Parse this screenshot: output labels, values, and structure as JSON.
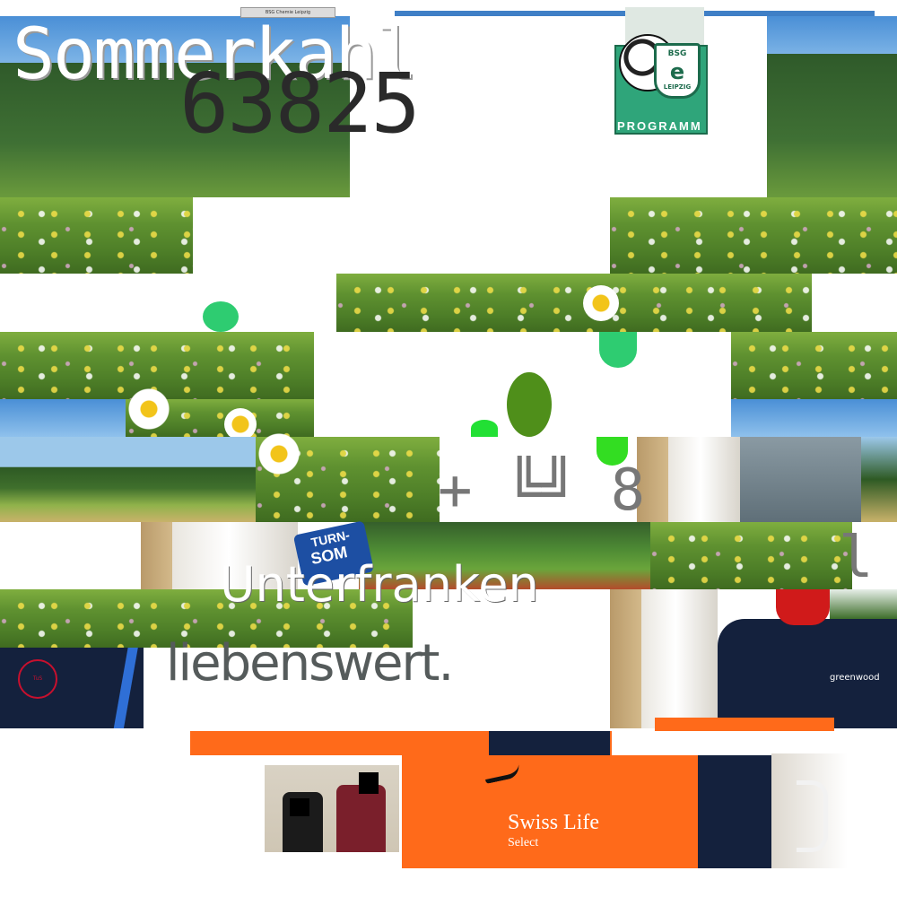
{
  "overlay_text": {
    "title": "Sommerkahl",
    "number": "63825",
    "region": "Unterfranken",
    "tagline": "liebenswert.",
    "glyphs": "+ ╚╝ 8",
    "corner_bar": "l"
  },
  "program": {
    "header_text": "BSG Chemie Leipzig",
    "crest_top": "BSG",
    "crest_letter": "e",
    "crest_bottom": "LEIPZIG",
    "footer_label": "PROGRAMM"
  },
  "sign": {
    "line1": "TURN-",
    "line2": "SOM"
  },
  "shirt": {
    "sponsor": "Swiss Life",
    "sponsor_sub": "Select",
    "brand_patch": "greenwood"
  },
  "badge": {
    "label": "TuS"
  },
  "icons": [
    "daisy-icon",
    "soccer-ball-icon",
    "crest-icon",
    "swoosh-icon",
    "door-handle-icon"
  ],
  "colors": {
    "meadow": "#5f9130",
    "sky": "#4a8fd6",
    "orange_shirt": "#ff6a1a",
    "navy_jacket": "#14213d",
    "program_green": "#2fa57a",
    "blob_green": "#2ecc71"
  }
}
